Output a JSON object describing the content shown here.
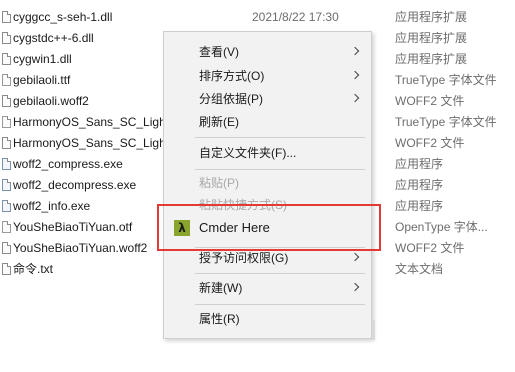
{
  "files": [
    {
      "name": "cyggcc_s-seh-1.dll",
      "date": "2021/8/22 17:30",
      "type": "应用程序扩展",
      "icon": "dll-file-icon"
    },
    {
      "name": "cygstdc++-6.dll",
      "date": "",
      "type": "应用程序扩展",
      "icon": "dll-file-icon"
    },
    {
      "name": "cygwin1.dll",
      "date": "",
      "type": "应用程序扩展",
      "icon": "dll-file-icon"
    },
    {
      "name": "gebilaoli.ttf",
      "date": "",
      "type": "TrueType 字体文件",
      "icon": "font-file-icon"
    },
    {
      "name": "gebilaoli.woff2",
      "date": "",
      "type": "WOFF2 文件",
      "icon": "file-icon"
    },
    {
      "name": "HarmonyOS_Sans_SC_Light",
      "date": "",
      "type": "TrueType 字体文件",
      "icon": "font-file-icon"
    },
    {
      "name": "HarmonyOS_Sans_SC_Light",
      "date": "",
      "type": "WOFF2 文件",
      "icon": "file-icon"
    },
    {
      "name": "woff2_compress.exe",
      "date": "",
      "type": "应用程序",
      "icon": "exe-file-icon"
    },
    {
      "name": "woff2_decompress.exe",
      "date": "",
      "type": "应用程序",
      "icon": "exe-file-icon"
    },
    {
      "name": "woff2_info.exe",
      "date": "",
      "type": "应用程序",
      "icon": "exe-file-icon"
    },
    {
      "name": "YouSheBiaoTiYuan.otf",
      "date": "",
      "type": "OpenType 字体...",
      "icon": "font-file-icon"
    },
    {
      "name": "YouSheBiaoTiYuan.woff2",
      "date": "",
      "type": "WOFF2 文件",
      "icon": "file-icon"
    },
    {
      "name": "命令.txt",
      "date": "",
      "type": "文本文档",
      "icon": "text-file-icon"
    }
  ],
  "menu": {
    "view": "查看(V)",
    "sort_by": "排序方式(O)",
    "group_by": "分组依据(P)",
    "refresh": "刷新(E)",
    "customize_folder": "自定义文件夹(F)...",
    "paste": "粘贴(P)",
    "paste_shortcut": "粘贴快捷方式(S)",
    "cmder_here": "Cmder Here",
    "cmder_icon_glyph": "λ",
    "give_access": "授予访问权限(G)",
    "new": "新建(W)",
    "properties": "属性(R)"
  },
  "colors": {
    "highlight_border": "#e53935",
    "cmder_icon_bg": "#8aa52e",
    "menu_bg": "#f2f2f2",
    "disabled_text": "#a8a8a8"
  }
}
